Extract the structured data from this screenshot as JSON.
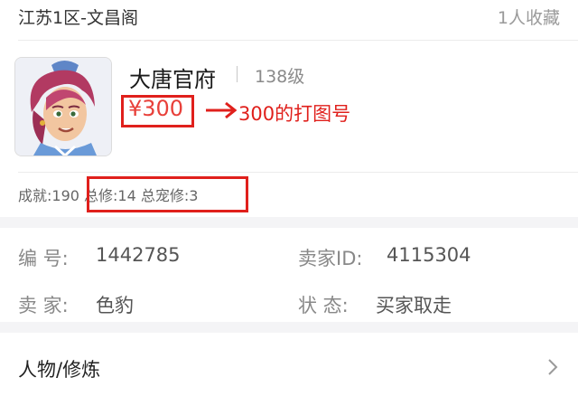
{
  "header": {
    "server": "江苏1区-文昌阁",
    "favorites": "1人收藏"
  },
  "character": {
    "name": "大唐官府",
    "level": "138级",
    "price": "¥300",
    "avatar_icon": "character-portrait"
  },
  "annotation": {
    "note": "300的打图号",
    "color": "#e0201c"
  },
  "stats": {
    "text": "成就:190 总修:14 总宠修:3"
  },
  "info": {
    "serial_label": "编  号:",
    "serial_value": "1442785",
    "seller_id_label": "卖家ID:",
    "seller_id_value": "4115304",
    "seller_label": "卖  家:",
    "seller_value": "色豹",
    "status_label": "状  态:",
    "status_value": "买家取走"
  },
  "section": {
    "title": "人物/修炼",
    "chevron_icon": "chevron-right-icon"
  }
}
